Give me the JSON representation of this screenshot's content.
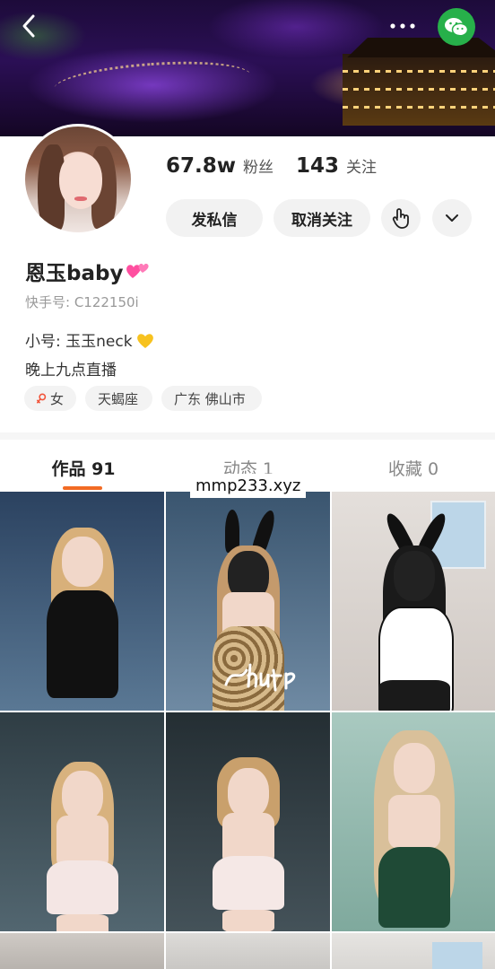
{
  "header": {
    "back_icon": "back-chevron-icon",
    "more_icon": "more-dots-icon",
    "share_icon": "wechat-icon",
    "back_glyph": "‹",
    "more_glyph": "•••"
  },
  "profile": {
    "followers_count": "67.8w",
    "followers_label": "粉丝",
    "following_count": "143",
    "following_label": "关注",
    "message_button": "发私信",
    "unfollow_button": "取消关注",
    "nickname": "恩玉baby",
    "kuaishou_id": "快手号: C122150i",
    "bio_line1": "小号: 玉玉neck",
    "bio_line2": "晚上九点直播",
    "tags": [
      {
        "label": "女",
        "icon": "female-icon"
      },
      {
        "label": "天蝎座"
      },
      {
        "label": "广东 佛山市"
      }
    ]
  },
  "tabs": [
    {
      "label": "作品 91",
      "active": true
    },
    {
      "label": "动态 1",
      "active": false
    },
    {
      "label": "收藏 0",
      "active": false
    }
  ],
  "watermark": "mmp233.xyz",
  "grid": {
    "items": [
      {
        "bg": "#3d5a78",
        "top": "#2b4260"
      },
      {
        "bg": "#4e6a84",
        "top": "#3a556f",
        "overlay_text": "shut up"
      },
      {
        "bg": "#e8e2de",
        "top": "#d9d2cd"
      },
      {
        "bg": "#3f4e55",
        "top": "#2f3d44"
      },
      {
        "bg": "#2f3a40",
        "top": "#242e33"
      },
      {
        "bg": "#8fb6ab",
        "top": "#a9c9c0"
      },
      {
        "bg": "#b8b3ae",
        "top": "#cfcac5"
      },
      {
        "bg": "#c9c7c4",
        "top": "#dddbd8"
      },
      {
        "bg": "#d8d6d3",
        "top": "#e6e4e1"
      }
    ]
  },
  "colors": {
    "accent": "#f26b24",
    "wechat": "#27b04a",
    "pill_bg": "#f2f2f2"
  }
}
